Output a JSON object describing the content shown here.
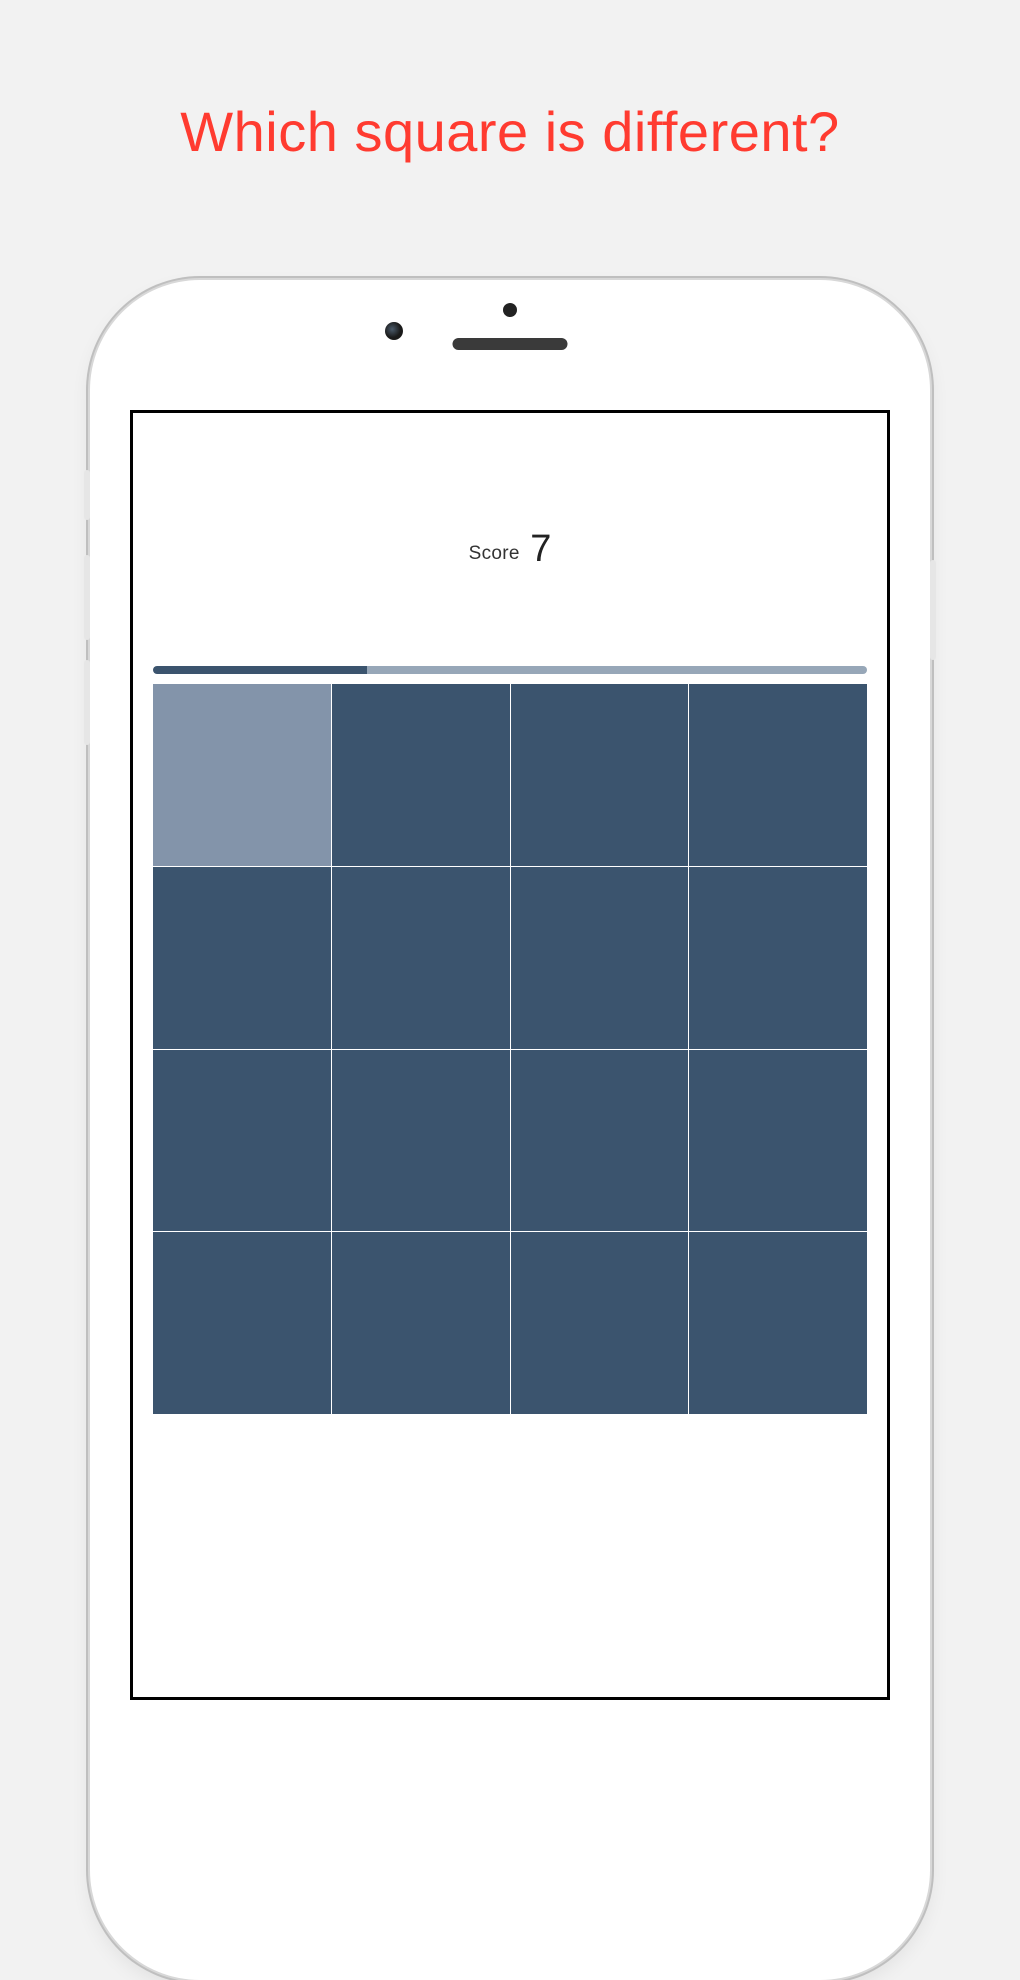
{
  "headline": "Which square is different?",
  "score": {
    "label": "Score",
    "value": "7"
  },
  "progress_percent": 30,
  "grid": {
    "rows": 4,
    "cols": 4,
    "base_color": "#3b546e",
    "odd_color": "#8394aa",
    "odd_index": 0
  }
}
